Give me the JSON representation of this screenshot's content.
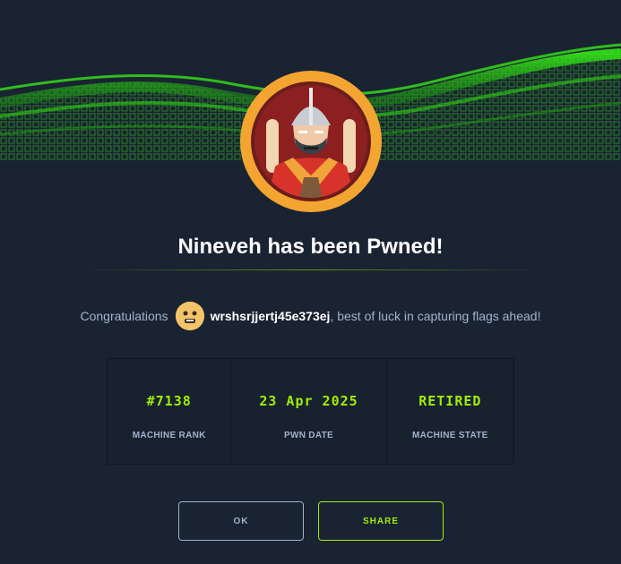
{
  "dialog": {
    "title": "Nineveh has been Pwned!",
    "congrats_prefix": "Congratulations",
    "username": "wrshsrjjertj45e373ej",
    "congrats_suffix": ", best of luck in capturing flags ahead!"
  },
  "stats": [
    {
      "value": "#7138",
      "label": "MACHINE RANK"
    },
    {
      "value": "23 Apr 2025",
      "label": "PWN DATE"
    },
    {
      "value": "RETIRED",
      "label": "MACHINE STATE"
    }
  ],
  "buttons": {
    "ok_label": "OK",
    "share_label": "SHARE"
  },
  "colors": {
    "background": "#1a2332",
    "accent": "#9fef00",
    "muted": "#a4b1cd",
    "avatar_ring": "#f4a531"
  },
  "icons": {
    "machine_avatar": "warrior-avatar",
    "user_avatar": "user-avatar"
  }
}
